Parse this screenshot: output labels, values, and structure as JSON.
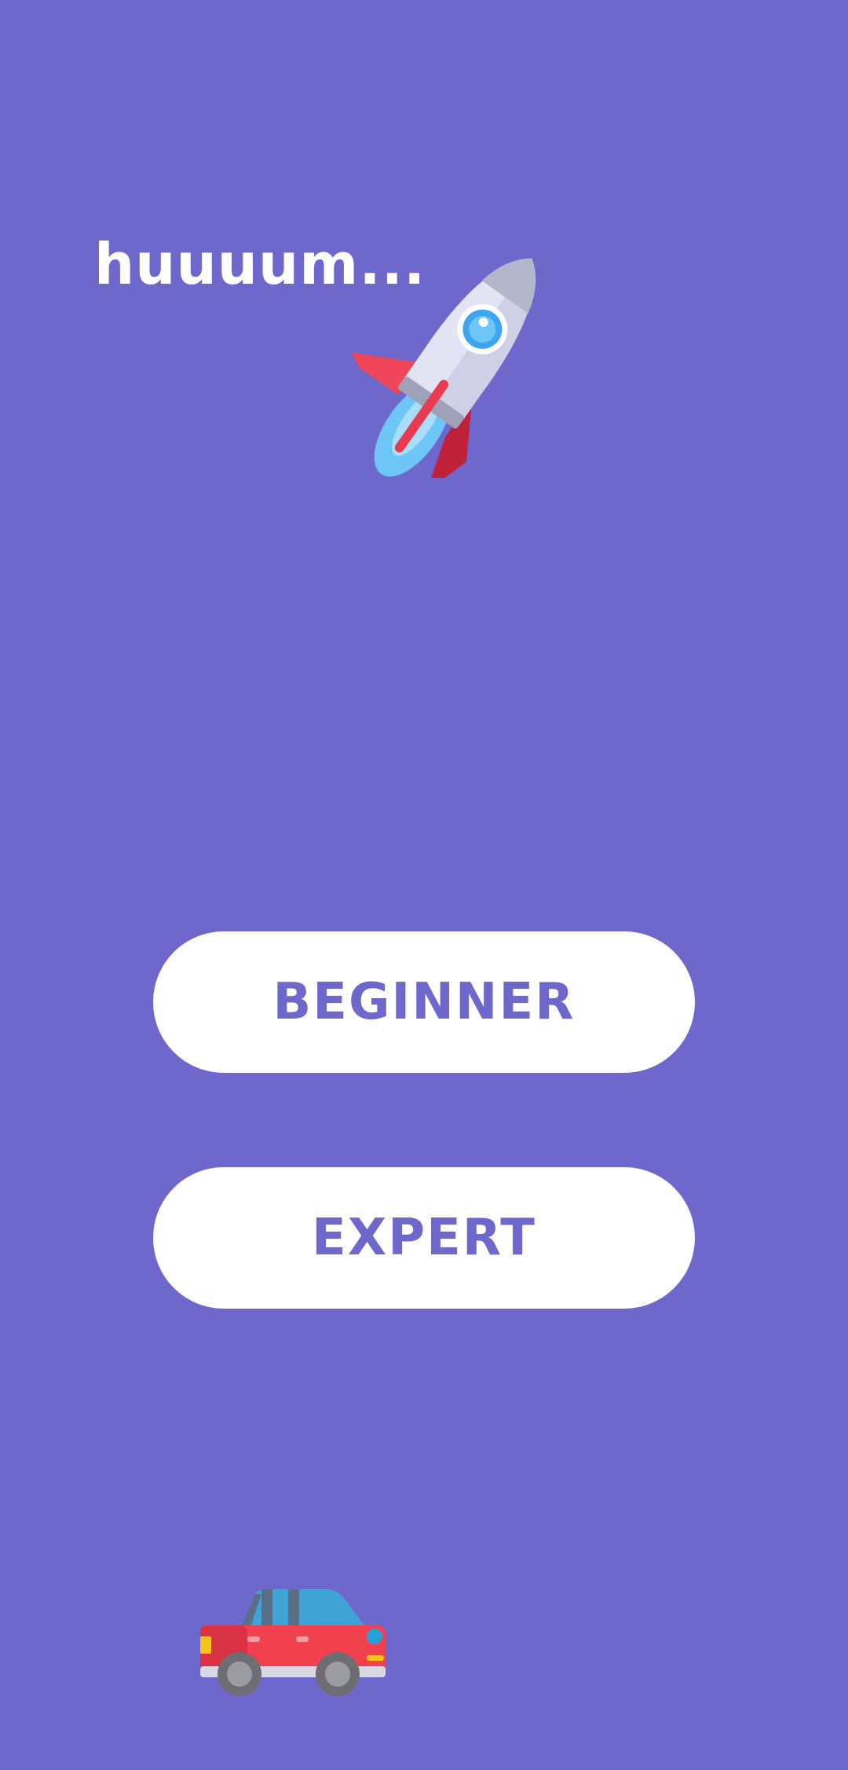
{
  "screen": {
    "headline": "huuuum...",
    "background_color": "#6e68cc"
  },
  "buttons": {
    "beginner_label": "BEGINNER",
    "expert_label": "EXPERT",
    "bg_color": "#ffffff",
    "text_color": "#6e68cc"
  },
  "icons": {
    "rocket": "rocket-icon",
    "car": "car-icon"
  }
}
